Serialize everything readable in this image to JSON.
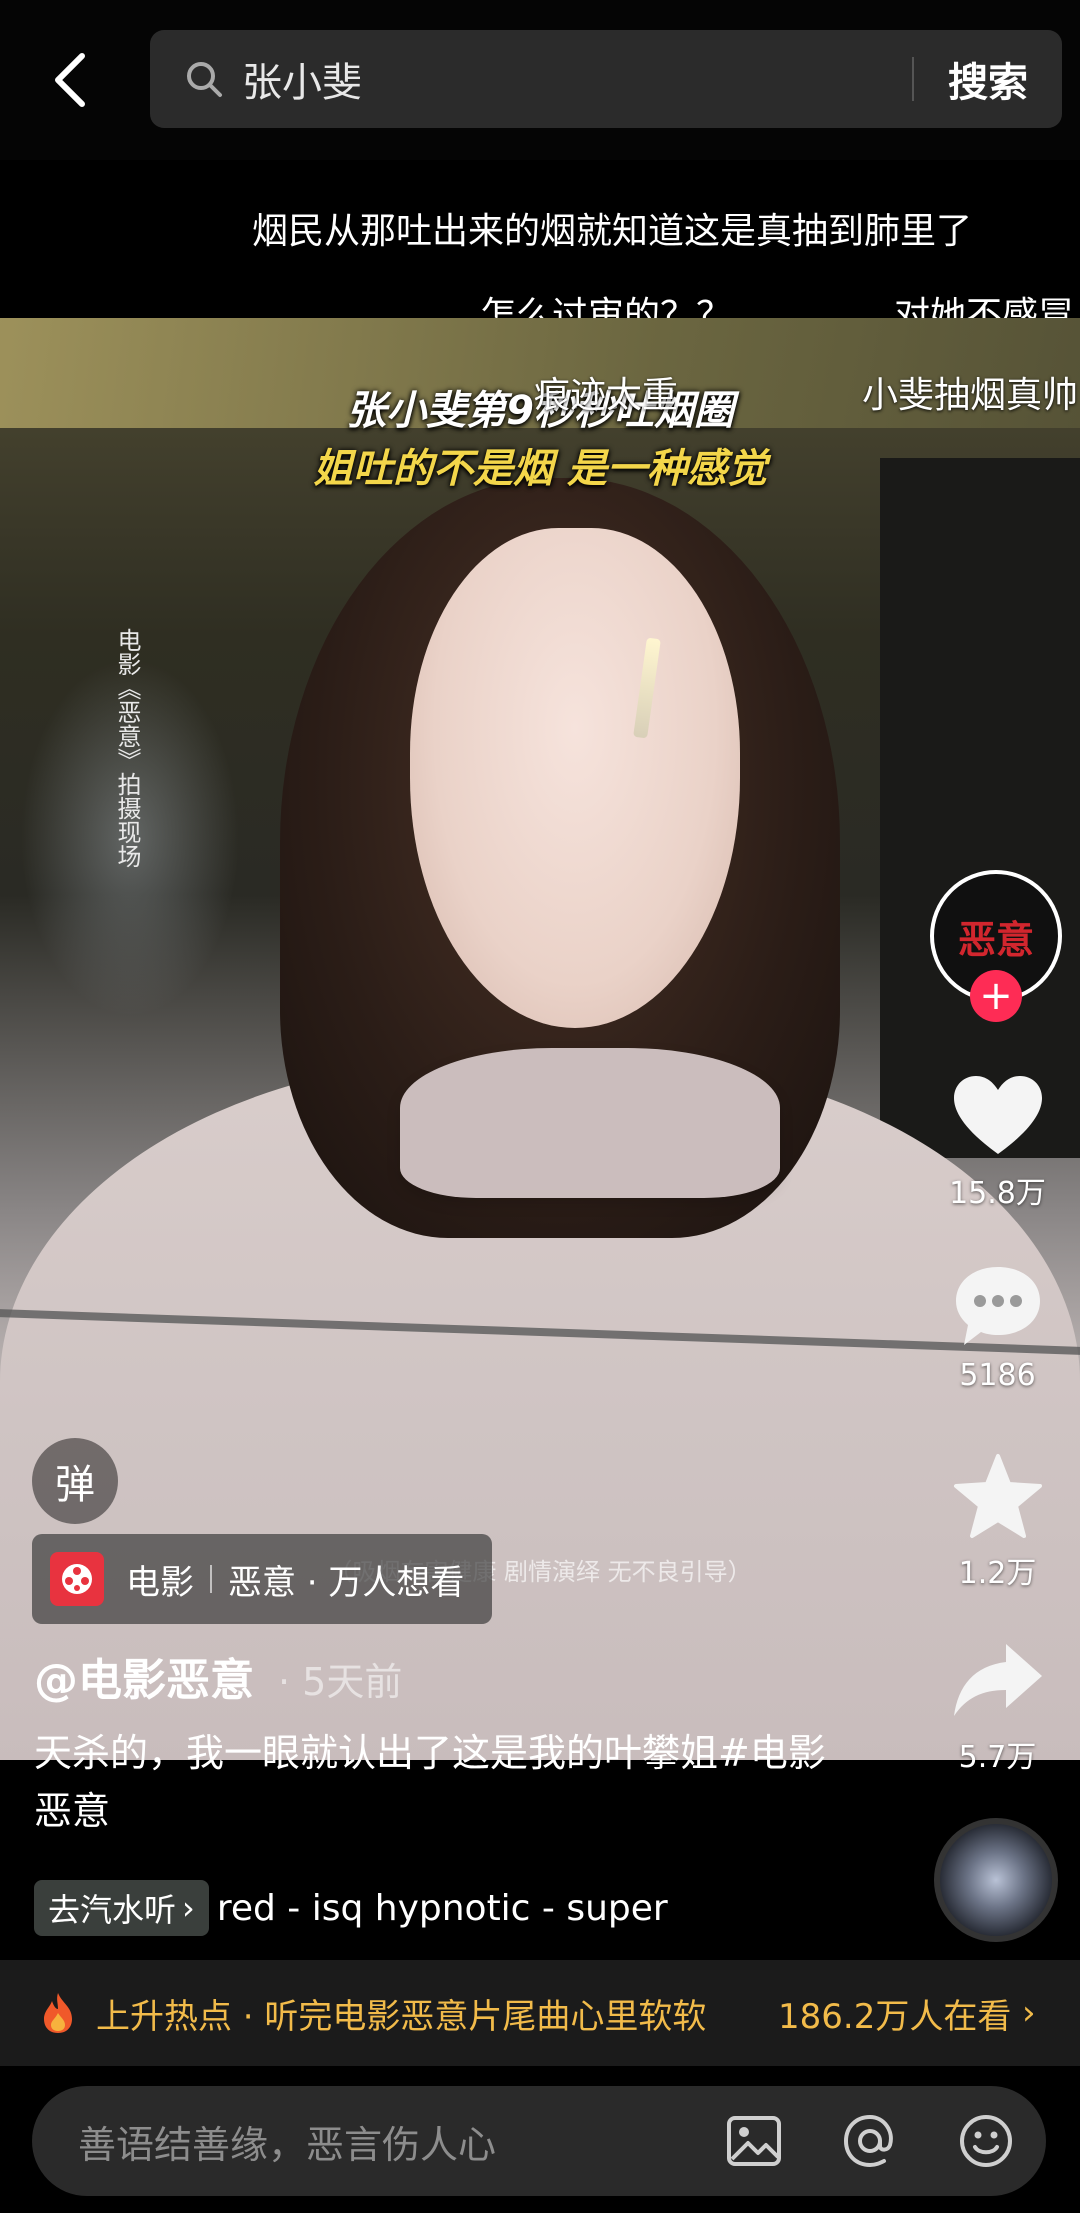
{
  "search": {
    "query": "张小斐",
    "button_label": "搜索"
  },
  "danmaku": [
    "烟民从那吐出来的烟就知道这是真抽到肺里了",
    "怎么过审的？？",
    "对她不感冒",
    "痕迹太重",
    "小斐抽烟真帅"
  ],
  "video": {
    "caption_line1": "张小斐第9秒秒吐烟圈",
    "caption_line2": "姐吐的不是烟 是一种感觉",
    "vertical_label": "电影《恶意》拍摄现场",
    "watermark_note": "（吸烟有害健康 剧情演绎 无不良引导）"
  },
  "creator": {
    "avatar_text": "恶意",
    "follow_symbol": "+"
  },
  "actions": {
    "likes": "15.8万",
    "comments": "5186",
    "favorites": "1.2万",
    "shares": "5.7万"
  },
  "danmu_toggle": "弹",
  "movie_chip": {
    "category": "电影",
    "title": "恶意 · 万人想看"
  },
  "post": {
    "author": "@电影恶意",
    "time": "· 5天前",
    "description": "天杀的，我一眼就认出了这是我的叶攀姐#电影恶意"
  },
  "music": {
    "chip_label": "去汽水听",
    "chip_arrow": "›",
    "track": "red - isq    hypnotic - super"
  },
  "hot": {
    "title": "上升热点 · 听完电影恶意片尾曲心里软软",
    "viewers": "186.2万人在看",
    "arrow": "›"
  },
  "comment": {
    "placeholder": "善语结善缘，恶言伤人心"
  },
  "colors": {
    "accent_red": "#fe2c55",
    "hot_gold": "#f2bb4a",
    "like_white": "#ffffff"
  },
  "icons": [
    "back-arrow-icon",
    "search-icon",
    "heart-icon",
    "comment-icon",
    "star-icon",
    "share-icon",
    "fire-icon",
    "image-icon",
    "at-icon",
    "emoji-icon",
    "film-icon"
  ]
}
